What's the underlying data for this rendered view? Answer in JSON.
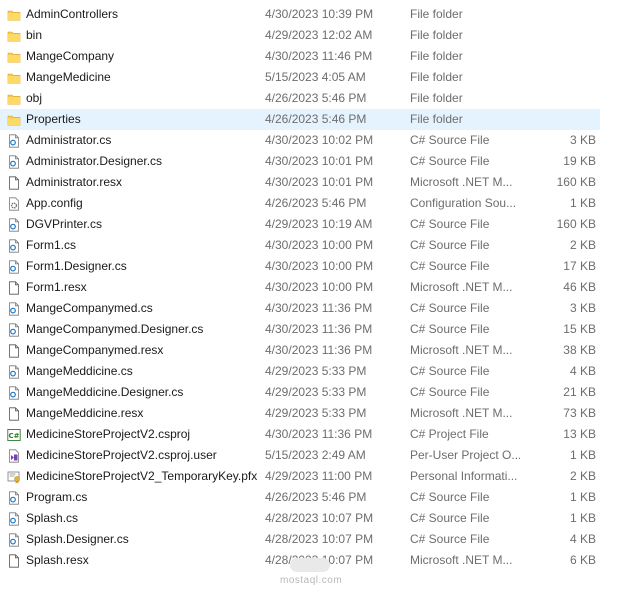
{
  "files": [
    {
      "name": "AdminControllers",
      "date": "4/30/2023 10:39 PM",
      "type": "File folder",
      "size": "",
      "icon": "folder-icon"
    },
    {
      "name": "bin",
      "date": "4/29/2023 12:02 AM",
      "type": "File folder",
      "size": "",
      "icon": "folder-icon"
    },
    {
      "name": "MangeCompany",
      "date": "4/30/2023 11:46 PM",
      "type": "File folder",
      "size": "",
      "icon": "folder-icon"
    },
    {
      "name": "MangeMedicine",
      "date": "5/15/2023 4:05 AM",
      "type": "File folder",
      "size": "",
      "icon": "folder-icon"
    },
    {
      "name": "obj",
      "date": "4/26/2023 5:46 PM",
      "type": "File folder",
      "size": "",
      "icon": "folder-icon"
    },
    {
      "name": "Properties",
      "date": "4/26/2023 5:46 PM",
      "type": "File folder",
      "size": "",
      "icon": "folder-icon",
      "selected": true
    },
    {
      "name": "Administrator.cs",
      "date": "4/30/2023 10:02 PM",
      "type": "C# Source File",
      "size": "3 KB",
      "icon": "csharp-file-icon"
    },
    {
      "name": "Administrator.Designer.cs",
      "date": "4/30/2023 10:01 PM",
      "type": "C# Source File",
      "size": "19 KB",
      "icon": "csharp-file-icon"
    },
    {
      "name": "Administrator.resx",
      "date": "4/30/2023 10:01 PM",
      "type": "Microsoft .NET M...",
      "size": "160 KB",
      "icon": "resx-file-icon"
    },
    {
      "name": "App.config",
      "date": "4/26/2023 5:46 PM",
      "type": "Configuration Sou...",
      "size": "1 KB",
      "icon": "config-file-icon"
    },
    {
      "name": "DGVPrinter.cs",
      "date": "4/29/2023 10:19 AM",
      "type": "C# Source File",
      "size": "160 KB",
      "icon": "csharp-file-icon"
    },
    {
      "name": "Form1.cs",
      "date": "4/30/2023 10:00 PM",
      "type": "C# Source File",
      "size": "2 KB",
      "icon": "csharp-file-icon"
    },
    {
      "name": "Form1.Designer.cs",
      "date": "4/30/2023 10:00 PM",
      "type": "C# Source File",
      "size": "17 KB",
      "icon": "csharp-file-icon"
    },
    {
      "name": "Form1.resx",
      "date": "4/30/2023 10:00 PM",
      "type": "Microsoft .NET M...",
      "size": "46 KB",
      "icon": "resx-file-icon"
    },
    {
      "name": "MangeCompanymed.cs",
      "date": "4/30/2023 11:36 PM",
      "type": "C# Source File",
      "size": "3 KB",
      "icon": "csharp-file-icon"
    },
    {
      "name": "MangeCompanymed.Designer.cs",
      "date": "4/30/2023 11:36 PM",
      "type": "C# Source File",
      "size": "15 KB",
      "icon": "csharp-file-icon"
    },
    {
      "name": "MangeCompanymed.resx",
      "date": "4/30/2023 11:36 PM",
      "type": "Microsoft .NET M...",
      "size": "38 KB",
      "icon": "resx-file-icon"
    },
    {
      "name": "MangeMeddicine.cs",
      "date": "4/29/2023 5:33 PM",
      "type": "C# Source File",
      "size": "4 KB",
      "icon": "csharp-file-icon"
    },
    {
      "name": "MangeMeddicine.Designer.cs",
      "date": "4/29/2023 5:33 PM",
      "type": "C# Source File",
      "size": "21 KB",
      "icon": "csharp-file-icon"
    },
    {
      "name": "MangeMeddicine.resx",
      "date": "4/29/2023 5:33 PM",
      "type": "Microsoft .NET M...",
      "size": "73 KB",
      "icon": "resx-file-icon"
    },
    {
      "name": "MedicineStoreProjectV2.csproj",
      "date": "4/30/2023 11:36 PM",
      "type": "C# Project File",
      "size": "13 KB",
      "icon": "csproj-file-icon"
    },
    {
      "name": "MedicineStoreProjectV2.csproj.user",
      "date": "5/15/2023 2:49 AM",
      "type": "Per-User Project O...",
      "size": "1 KB",
      "icon": "vs-user-file-icon"
    },
    {
      "name": "MedicineStoreProjectV2_TemporaryKey.pfx",
      "date": "4/29/2023 11:00 PM",
      "type": "Personal Informati...",
      "size": "2 KB",
      "icon": "certificate-file-icon"
    },
    {
      "name": "Program.cs",
      "date": "4/26/2023 5:46 PM",
      "type": "C# Source File",
      "size": "1 KB",
      "icon": "csharp-file-icon"
    },
    {
      "name": "Splash.cs",
      "date": "4/28/2023 10:07 PM",
      "type": "C# Source File",
      "size": "1 KB",
      "icon": "csharp-file-icon"
    },
    {
      "name": "Splash.Designer.cs",
      "date": "4/28/2023 10:07 PM",
      "type": "C# Source File",
      "size": "4 KB",
      "icon": "csharp-file-icon"
    },
    {
      "name": "Splash.resx",
      "date": "4/28/2023 10:07 PM",
      "type": "Microsoft .NET M...",
      "size": "6 KB",
      "icon": "resx-file-icon"
    }
  ],
  "watermark": "mostaql.com",
  "colors": {
    "folder": "#f6c94c",
    "selected_row": "#e5f3ff",
    "meta_text": "#6d6d6d"
  }
}
